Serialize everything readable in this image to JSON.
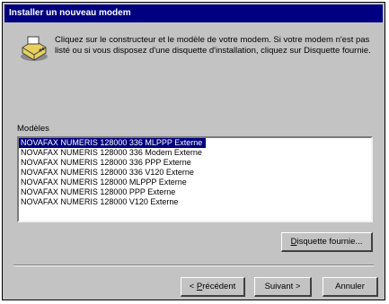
{
  "window": {
    "title": "Installer un nouveau modem"
  },
  "icon": {
    "name": "modem-install-icon"
  },
  "instructions": "Cliquez sur le constructeur et le modèle de votre modem. Si votre modem n'est pas listé ou si vous disposez d'une disquette d'installation, cliquez sur Disquette fournie.",
  "models": {
    "label": "Modèles",
    "items": [
      "NOVAFAX NUMERIS 128000 336 MLPPP Externe",
      "NOVAFAX NUMERIS 128000 336 Modem Externe",
      "NOVAFAX NUMERIS 128000 336 PPP Externe",
      "NOVAFAX NUMERIS 128000 336 V120 Externe",
      "NOVAFAX NUMERIS 128000 MLPPP Externe",
      "NOVAFAX NUMERIS 128000 PPP Externe",
      "NOVAFAX NUMERIS 128000 V120 Externe"
    ],
    "selected_index": 0
  },
  "buttons": {
    "disk_prefix": "",
    "disk_access": "D",
    "disk_rest": "isquette fournie...",
    "back_prefix": "< ",
    "back_access": "P",
    "back_rest": "récédent",
    "next_label": "Suivant >",
    "cancel_label": "Annuler"
  },
  "colors": {
    "titlebar": "#000080",
    "selection": "#000080",
    "face": "#c3c3c3"
  }
}
